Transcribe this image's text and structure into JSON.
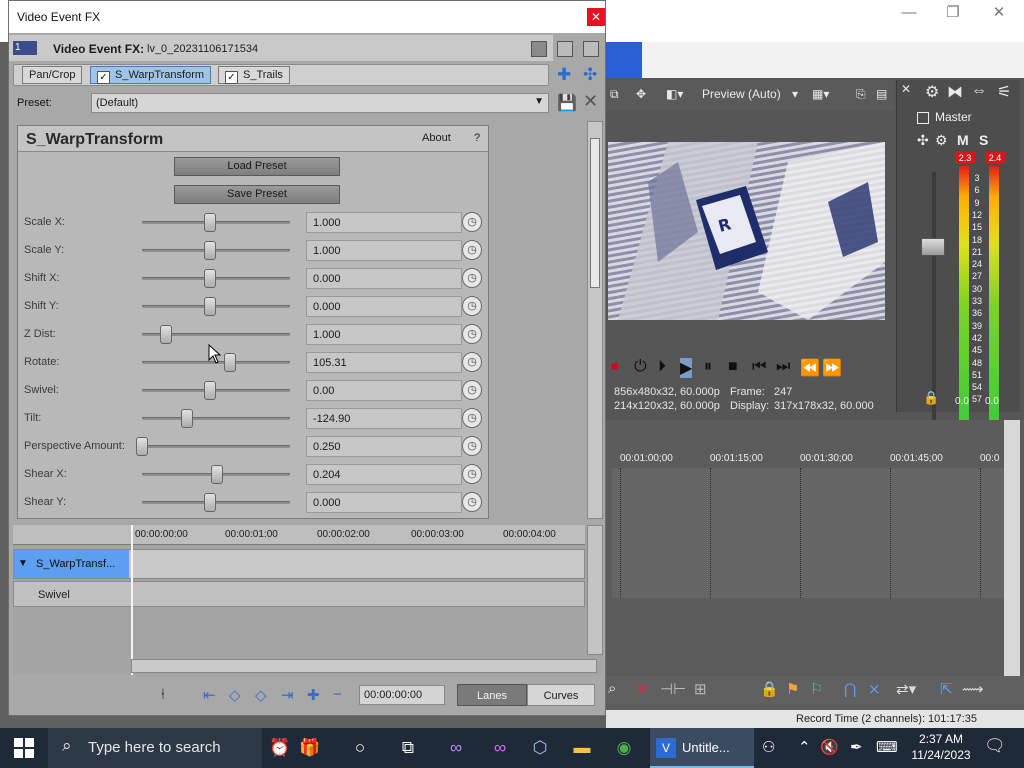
{
  "app": {
    "window_controls": [
      "—",
      "❐",
      "✕"
    ]
  },
  "fx_window": {
    "title": "Video Event FX",
    "badge": "1",
    "header_title": "Video Event FX:",
    "header_clip": "lv_0_20231106171534",
    "chain": [
      "Pan/Crop",
      "S_WarpTransform",
      "S_Trails"
    ],
    "preset_label": "Preset:",
    "preset_value": "(Default)",
    "plugin": {
      "name": "S_WarpTransform",
      "about": "About",
      "help": "?",
      "load_preset": "Load Preset",
      "save_preset": "Save Preset"
    },
    "params": [
      {
        "label": "Scale X:",
        "value": "1.000",
        "pos": 0.5
      },
      {
        "label": "Scale Y:",
        "value": "1.000",
        "pos": 0.5
      },
      {
        "label": "Shift X:",
        "value": "0.000",
        "pos": 0.5
      },
      {
        "label": "Shift Y:",
        "value": "0.000",
        "pos": 0.5
      },
      {
        "label": "Z Dist:",
        "value": "1.000",
        "pos": 0.18
      },
      {
        "label": "Rotate:",
        "value": "105.31",
        "pos": 0.65
      },
      {
        "label": "Swivel:",
        "value": "0.00",
        "pos": 0.5
      },
      {
        "label": "Tilt:",
        "value": "-124.90",
        "pos": 0.33
      },
      {
        "label": "Perspective Amount:",
        "value": "0.250",
        "pos": 0.0
      },
      {
        "label": "Shear X:",
        "value": "0.204",
        "pos": 0.55
      },
      {
        "label": "Shear Y:",
        "value": "0.000",
        "pos": 0.5
      }
    ],
    "keyframe": {
      "ruler": [
        "00:00:00:00",
        "00:00:01:00",
        "00:00:02:00",
        "00:00:03:00",
        "00:00:04:00"
      ],
      "track_name": "S_WarpTransf...",
      "sub_track": "Swivel",
      "time": "00:00:00:00",
      "lanes": "Lanes",
      "curves": "Curves"
    }
  },
  "preview": {
    "mode": "Preview (Auto)",
    "info_left_1": "856x480x32, 60.000p",
    "info_left_2": "214x120x32, 60.000p",
    "frame_label": "Frame:",
    "frame_value": "247",
    "display_label": "Display:",
    "display_value": "317x178x32, 60.000"
  },
  "mixer": {
    "label": "Master",
    "m": "M",
    "s": "S",
    "peak_left": "2.3",
    "peak_right": "2.4",
    "scale": [
      "3",
      "6",
      "9",
      "12",
      "15",
      "18",
      "21",
      "24",
      "27",
      "30",
      "33",
      "36",
      "39",
      "42",
      "45",
      "48",
      "51",
      "54",
      "57"
    ],
    "bottom_left": "0.0",
    "bottom_right": "0.0"
  },
  "timeline": {
    "ruler": [
      "00:01:00;00",
      "00:01:15;00",
      "00:01:30;00",
      "00:01:45;00",
      "00:0"
    ],
    "status": "Record Time (2 channels): 101:17:35"
  },
  "taskbar": {
    "search_placeholder": "Type here to search",
    "active_app": "Untitle...",
    "time": "2:37 AM",
    "date": "11/24/2023"
  }
}
